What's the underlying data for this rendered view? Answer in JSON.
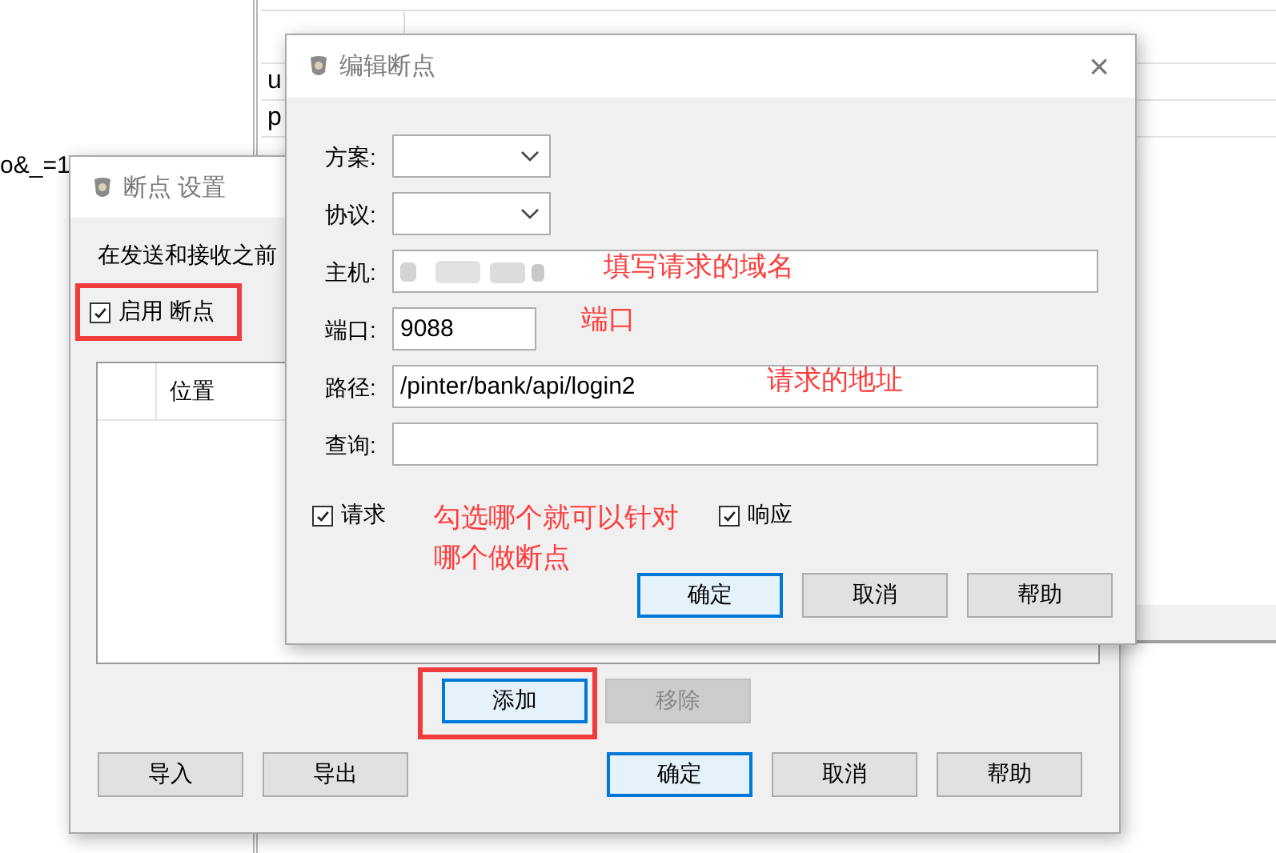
{
  "background": {
    "query_fragment": "o&_=1",
    "table": {
      "rows": [
        "u",
        "p"
      ]
    }
  },
  "settings_dialog": {
    "title": "断点 设置",
    "intro": "在发送和接收之前",
    "enable": {
      "label": "启用 断点",
      "checked": true
    },
    "list": {
      "columns": [
        "",
        "位置"
      ]
    },
    "list_buttons": [
      {
        "label": "添加",
        "focused": true,
        "disabled": false
      },
      {
        "label": "移除",
        "focused": false,
        "disabled": true
      }
    ],
    "footer_buttons": [
      {
        "label": "导入",
        "focused": false
      },
      {
        "label": "导出",
        "focused": false
      },
      {
        "label": "确定",
        "focused": true
      },
      {
        "label": "取消",
        "focused": false
      },
      {
        "label": "帮助",
        "focused": false
      }
    ]
  },
  "edit_dialog": {
    "title": "编辑断点",
    "close": "×",
    "fields": [
      {
        "kind": "combo",
        "label": "方案:"
      },
      {
        "kind": "combo",
        "label": "协议:"
      },
      {
        "kind": "long",
        "label": "主机:",
        "redacted": true
      },
      {
        "kind": "short",
        "label": "端口:",
        "value": "9088"
      },
      {
        "kind": "long",
        "label": "路径:",
        "value": "/pinter/bank/api/login2"
      },
      {
        "kind": "long",
        "label": "查询:"
      }
    ],
    "options": [
      {
        "label": "请求",
        "checked": true
      },
      {
        "label": "响应",
        "checked": true
      }
    ],
    "buttons": [
      {
        "label": "确定",
        "focused": true
      },
      {
        "label": "取消",
        "focused": false
      },
      {
        "label": "帮助",
        "focused": false
      }
    ]
  },
  "annotations": [
    {
      "text": "填写请求的域名",
      "kind": "host"
    },
    {
      "text": "端口",
      "kind": "port"
    },
    {
      "text": "请求的地址",
      "kind": "path"
    },
    {
      "text": "勾选哪个就可以针对",
      "kind": "check1"
    },
    {
      "text": "哪个做断点",
      "kind": "check2"
    }
  ]
}
